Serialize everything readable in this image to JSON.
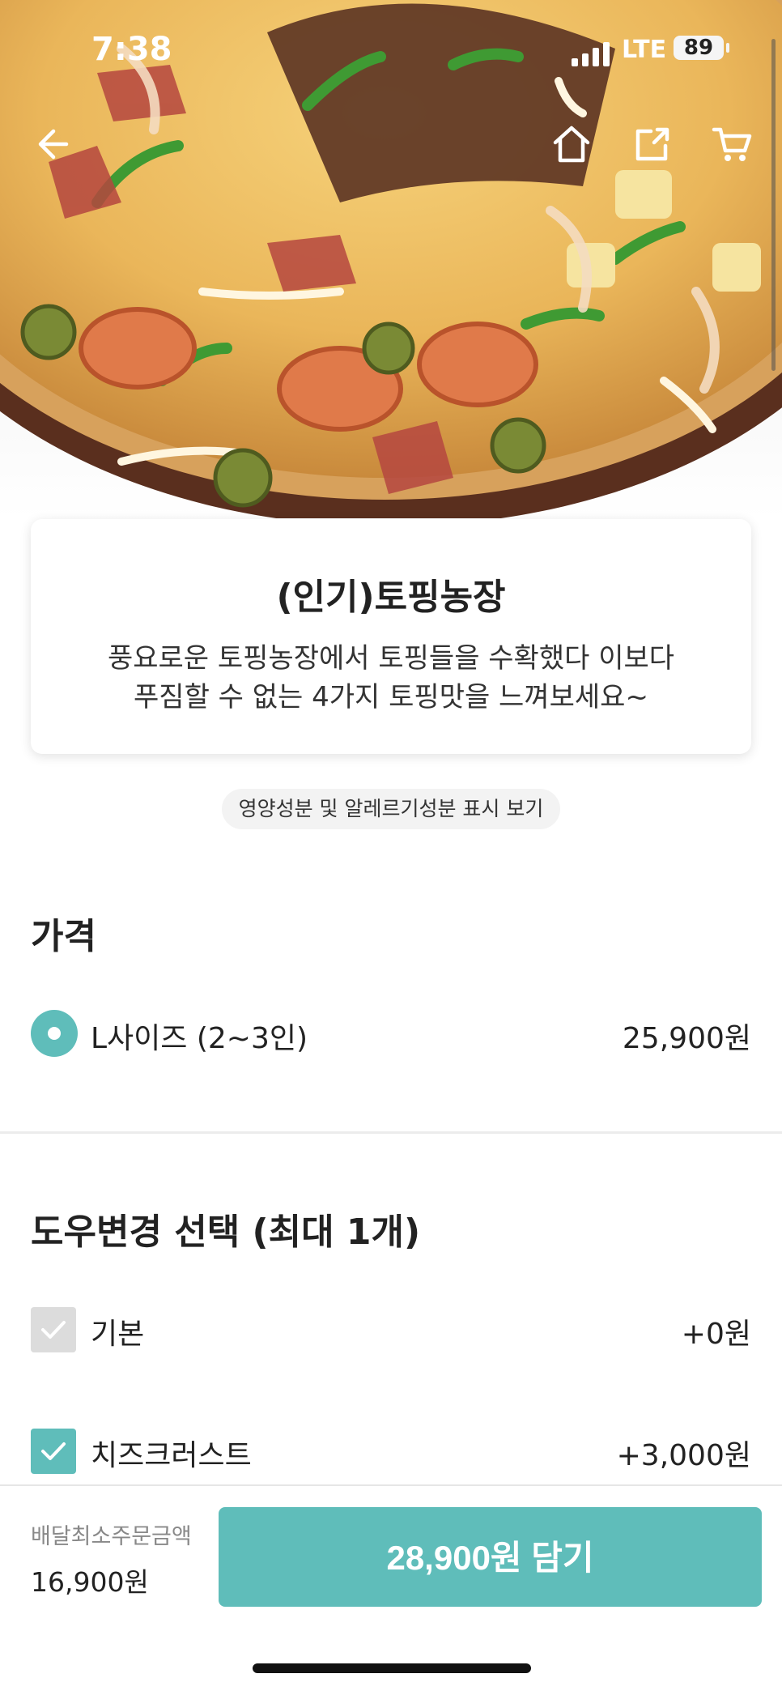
{
  "status_bar": {
    "time": "7:38",
    "network": "LTE",
    "battery": "89"
  },
  "nav": {
    "back_icon": "arrow-left-icon",
    "home_icon": "home-icon",
    "share_icon": "share-icon",
    "cart_icon": "cart-icon"
  },
  "product": {
    "name": "(인기)토핑농장",
    "description_line1": "풍요로운 토핑농장에서 토핑들을 수확했다 이보다",
    "description_line2": "푸짐할 수 없는 4가지 토핑맛을 느껴보세요~"
  },
  "nutrition_link": "영양성분 및 알레르기성분 표시 보기",
  "price_section": {
    "title": "가격",
    "options": [
      {
        "label": "L사이즈 (2~3인)",
        "price": "25,900원",
        "selected": true
      }
    ]
  },
  "dough_section": {
    "title": "도우변경 선택 (최대 1개)",
    "options": [
      {
        "label": "기본",
        "price": "+0원",
        "checked": false
      },
      {
        "label": "치즈크러스트",
        "price": "+3,000원",
        "checked": true
      }
    ]
  },
  "bottom_bar": {
    "min_order_label": "배달최소주문금액",
    "min_order_value": "16,900원",
    "add_button_label": "28,900원 담기"
  },
  "colors": {
    "accent": "#5fbdba",
    "unchecked": "#dcdcdc"
  }
}
